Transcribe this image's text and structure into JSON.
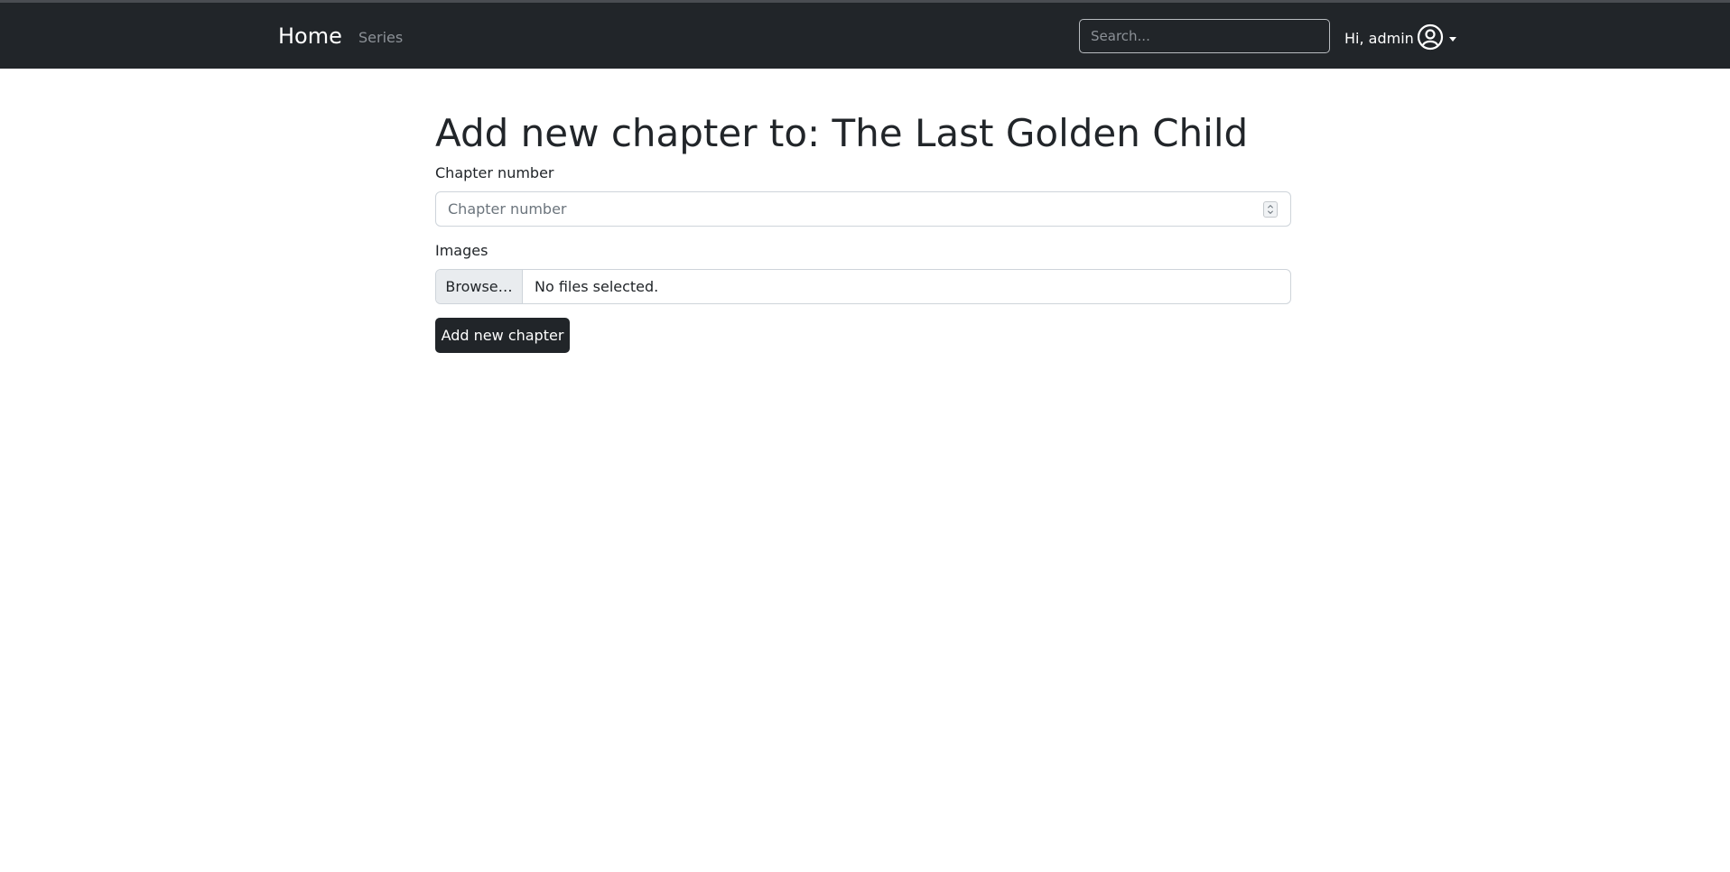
{
  "navbar": {
    "brand": "Home",
    "links": [
      "Series"
    ],
    "search_placeholder": "Search...",
    "user_greeting": "Hi, admin",
    "user_icon": "user-circle-icon",
    "dropdown_icon": "caret-down-icon"
  },
  "main": {
    "title": "Add new chapter to: The Last Golden Child",
    "chapter_label": "Chapter number",
    "chapter_placeholder": "Chapter number",
    "chapter_spinner_icon": "number-spinner-icon",
    "images_label": "Images",
    "browse_label": "Browse…",
    "file_status": "No files selected.",
    "submit_label": "Add new chapter"
  },
  "colors": {
    "navbar_bg": "#212529",
    "button_bg": "#212529",
    "muted_link": "#8c9197"
  }
}
